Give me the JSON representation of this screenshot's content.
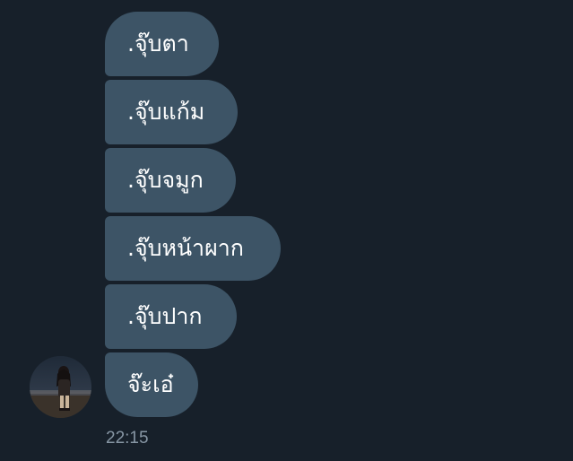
{
  "conversation": {
    "messages": [
      {
        "text": ".จุ๊บตา"
      },
      {
        "text": ".จุ๊บแก้ม"
      },
      {
        "text": ".จุ๊บจมูก"
      },
      {
        "text": ".จุ๊บหน้าผาก"
      },
      {
        "text": ".จุ๊บปาก"
      },
      {
        "text": "จ๊ะเอ๋"
      }
    ],
    "timestamp": "22:15"
  },
  "colors": {
    "background": "#17202a",
    "bubble": "#3d5466",
    "bubble_text": "#ffffff",
    "timestamp": "#8796a4"
  },
  "icons": {
    "sender_avatar": "profile-photo"
  }
}
